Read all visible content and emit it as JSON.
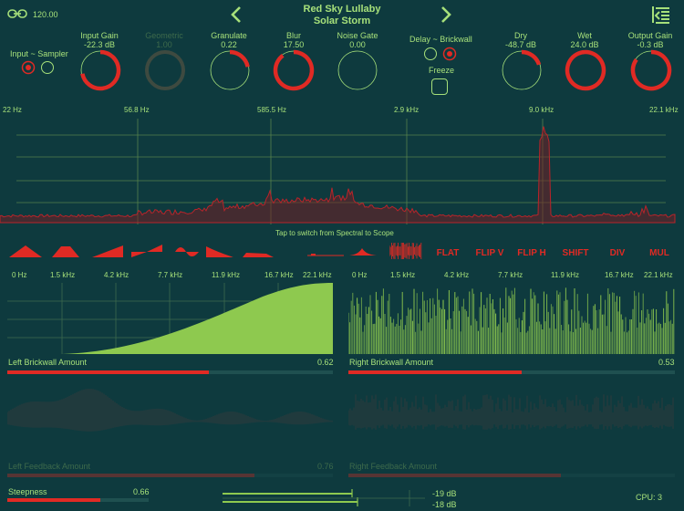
{
  "header": {
    "bpm": "120.00",
    "title": "Red Sky Lullaby",
    "subtitle": "Solar Storm",
    "icons": {
      "link": "link-icon",
      "prev": "chevron-left-icon",
      "next": "chevron-right-icon",
      "menu": "menu-collapse-icon"
    }
  },
  "routing": {
    "input_label": "Input ~ Sampler",
    "delay_label": "Delay ~ Brickwall",
    "freeze_label": "Freeze"
  },
  "knobs": [
    {
      "label": "Input Gain",
      "value": "-22.3 dB",
      "level": 0.72,
      "active": true
    },
    {
      "label": "Geometric",
      "value": "1.00",
      "level": 1.0,
      "active": false
    },
    {
      "label": "Granulate",
      "value": "0.22",
      "level": 0.22,
      "active": true
    },
    {
      "label": "Blur",
      "value": "17.50",
      "level": 0.9,
      "active": true
    },
    {
      "label": "Noise Gate",
      "value": "0.00",
      "level": 0.0,
      "active": true
    },
    {
      "label": "Dry",
      "value": "-48.7 dB",
      "level": 0.2,
      "active": true
    },
    {
      "label": "Wet",
      "value": "24.0 dB",
      "level": 1.0,
      "active": true
    },
    {
      "label": "Output Gain",
      "value": "-0.3 dB",
      "level": 0.85,
      "active": true
    }
  ],
  "spectrum": {
    "freq_labels": [
      "22 Hz",
      "56.8 Hz",
      "585.5 Hz",
      "2.9 kHz",
      "9.0 kHz",
      "22.1 kHz"
    ],
    "hint": "Tap to switch from Spectral to Scope"
  },
  "shape_buttons": [
    "FLAT",
    "FLIP V",
    "FLIP H",
    "SHIFT",
    "DIV",
    "MUL"
  ],
  "left_panel": {
    "freq_labels": [
      "0 Hz",
      "1.5 kHz",
      "4.2 kHz",
      "7.7 kHz",
      "11.9 kHz",
      "16.7 kHz",
      "22.1 kHz"
    ],
    "amount_label": "Left Brickwall Amount",
    "amount_value": "0.62",
    "amount": 0.62,
    "feedback_label": "Left Feedback Amount",
    "feedback_value": "0.76",
    "feedback": 0.76
  },
  "right_panel": {
    "freq_labels": [
      "0 Hz",
      "1.5 kHz",
      "4.2 kHz",
      "7.7 kHz",
      "11.9 kHz",
      "16.7 kHz",
      "22.1 kHz"
    ],
    "amount_label": "Right Brickwall Amount",
    "amount_value": "0.53",
    "amount": 0.53,
    "feedback_label": "Right Feedback Amount",
    "feedback": 0.65
  },
  "footer": {
    "steepness_label": "Steepness",
    "steepness_value": "0.66",
    "steepness": 0.66,
    "meter_top": "-19 dB",
    "meter_bottom": "-18 dB",
    "cpu": "CPU: 3"
  },
  "colors": {
    "accent": "#e02a24",
    "text": "#a6e07a",
    "bg": "#0e3a3e",
    "fill": "#8ec94f"
  }
}
